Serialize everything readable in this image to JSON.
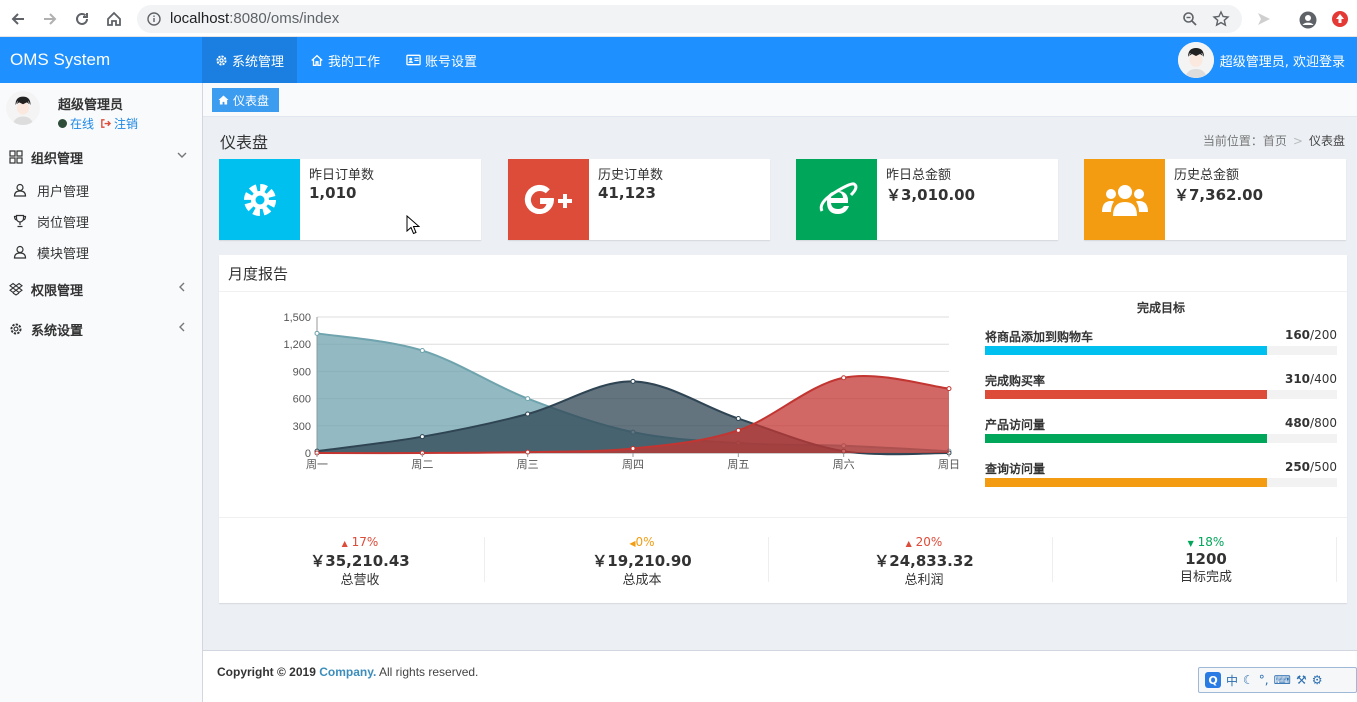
{
  "browser": {
    "url_host": "localhost",
    "url_path": ":8080/oms/index"
  },
  "header": {
    "brand": "OMS System",
    "nav": [
      {
        "label": "系统管理",
        "icon": "gear-icon"
      },
      {
        "label": "我的工作",
        "icon": "home-icon"
      },
      {
        "label": "账号设置",
        "icon": "id-card-icon"
      }
    ],
    "user_greeting": "超级管理员, 欢迎登录"
  },
  "sidebar": {
    "user_name": "超级管理员",
    "status_online": "在线",
    "logout": "注销",
    "groups": [
      {
        "label": "组织管理",
        "icon": "grid-icon",
        "children": [
          {
            "label": "用户管理",
            "icon": "user-icon"
          },
          {
            "label": "岗位管理",
            "icon": "trophy-icon"
          },
          {
            "label": "模块管理",
            "icon": "user-icon"
          }
        ]
      },
      {
        "label": "权限管理",
        "icon": "dropbox-icon"
      },
      {
        "label": "系统设置",
        "icon": "gear-icon"
      }
    ]
  },
  "tabs": [
    {
      "label": "仪表盘",
      "icon": "home-icon"
    }
  ],
  "page": {
    "title": "仪表盘",
    "breadcrumb_prefix": "当前位置：首页",
    "breadcrumb_sep": ">",
    "breadcrumb_current": "仪表盘"
  },
  "info_boxes": [
    {
      "title": "昨日订单数",
      "value": "1,010",
      "icon": "gear-icon",
      "color": "#00c0ef"
    },
    {
      "title": "历史订单数",
      "value": "41,123",
      "icon": "google-plus-icon",
      "color": "#dd4b39"
    },
    {
      "title": "昨日总金额",
      "value": "￥3,010.00",
      "icon": "internet-explorer-icon",
      "color": "#00a65a"
    },
    {
      "title": "历史总金额",
      "value": "￥7,362.00",
      "icon": "users-icon",
      "color": "#f39c12"
    }
  ],
  "report": {
    "title": "月度报告",
    "goals_title": "完成目标",
    "goals": [
      {
        "label": "将商品添加到购物车",
        "done": "160",
        "total": "/200",
        "fraction": 0.8,
        "color": "#00c0ef"
      },
      {
        "label": "完成购买率",
        "done": "310",
        "total": "/400",
        "fraction": 0.8,
        "color": "#dd4b39"
      },
      {
        "label": "产品访问量",
        "done": "480",
        "total": "/800",
        "fraction": 0.8,
        "color": "#00a65a"
      },
      {
        "label": "查询访问量",
        "done": "250",
        "total": "/500",
        "fraction": 0.8,
        "color": "#f39c12"
      }
    ],
    "stats": [
      {
        "pct": "17%",
        "dir": "up",
        "color": "#dd4b39",
        "amount": "￥35,210.43",
        "label": "总营收"
      },
      {
        "pct": "0%",
        "dir": "left",
        "color": "#f39c12",
        "amount": "￥19,210.90",
        "label": "总成本"
      },
      {
        "pct": "20%",
        "dir": "up",
        "color": "#dd4b39",
        "amount": "￥24,833.32",
        "label": "总利润"
      },
      {
        "pct": "18%",
        "dir": "down",
        "color": "#00a65a",
        "amount": "1200",
        "label": "目标完成"
      }
    ]
  },
  "chart_data": {
    "type": "area",
    "categories": [
      "周一",
      "周二",
      "周三",
      "周四",
      "周五",
      "周六",
      "周日"
    ],
    "ylim": [
      0,
      1500
    ],
    "yticks": [
      "0",
      "300",
      "600",
      "900",
      "1,200",
      "1,500"
    ],
    "grid": true,
    "series": [
      {
        "values": [
          1320,
          1130,
          600,
          230,
          110,
          80,
          20
        ],
        "color": "#6fa3ad"
      },
      {
        "values": [
          20,
          180,
          430,
          790,
          380,
          20,
          0
        ],
        "color": "#2f4554"
      },
      {
        "values": [
          0,
          0,
          10,
          50,
          250,
          830,
          710
        ],
        "color": "#c23531"
      }
    ]
  },
  "footer": {
    "copyright": "Copyright © 2019",
    "company": "Company.",
    "rights": "All rights reserved."
  },
  "ime": {
    "lang": "中"
  }
}
